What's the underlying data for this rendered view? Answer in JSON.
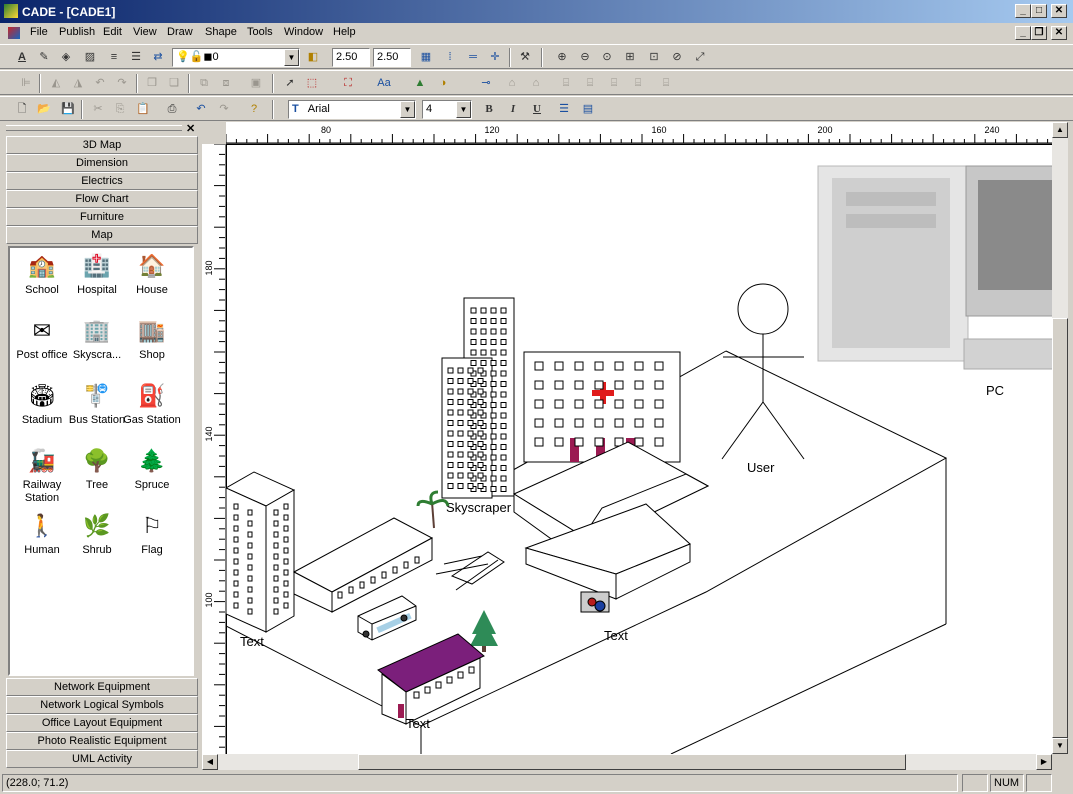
{
  "window": {
    "title": "CADE - [CADE1]"
  },
  "menu": [
    "File",
    "Publish",
    "Edit",
    "View",
    "Draw",
    "Shape",
    "Tools",
    "Window",
    "Help"
  ],
  "toolbar": {
    "layer_value": "0",
    "line_width": "2.50",
    "line_spacing": "2.50",
    "font_name": "Arial",
    "font_size": "4",
    "bold": "B",
    "italic": "I",
    "underline": "U"
  },
  "library": {
    "categories_top": [
      "3D Map",
      "Dimension",
      "Electrics",
      "Flow Chart",
      "Furniture",
      "Map"
    ],
    "categories_bottom": [
      "Network Equipment",
      "Network Logical Symbols",
      "Office Layout Equipment",
      "Photo Realistic Equipment",
      "UML Activity"
    ],
    "shapes": [
      {
        "label": "School",
        "icon": "school-icon"
      },
      {
        "label": "Hospital",
        "icon": "hospital-icon"
      },
      {
        "label": "House",
        "icon": "house-icon"
      },
      {
        "label": "Post office",
        "icon": "post-office-icon"
      },
      {
        "label": "Skyscra...",
        "icon": "skyscraper-icon"
      },
      {
        "label": "Shop",
        "icon": "shop-icon"
      },
      {
        "label": "Stadium",
        "icon": "stadium-icon"
      },
      {
        "label": "Bus Station",
        "icon": "bus-station-icon"
      },
      {
        "label": "Gas Station",
        "icon": "gas-station-icon"
      },
      {
        "label": "Railway Station",
        "icon": "railway-station-icon"
      },
      {
        "label": "Tree",
        "icon": "tree-icon"
      },
      {
        "label": "Spruce",
        "icon": "spruce-icon"
      },
      {
        "label": "Human",
        "icon": "human-icon"
      },
      {
        "label": "Shrub",
        "icon": "shrub-icon"
      },
      {
        "label": "Flag",
        "icon": "flag-icon"
      }
    ]
  },
  "ruler": {
    "top_ticks": [
      "80",
      "120",
      "160",
      "200",
      "240"
    ],
    "left_ticks": [
      "180",
      "140",
      "100"
    ]
  },
  "drawing": {
    "labels": {
      "skyscraper": "Skyscraper",
      "user": "User",
      "pc": "PC",
      "text1": "Text",
      "text2": "Text",
      "text3": "Text"
    }
  },
  "status": {
    "coords": "(228.0; 71.2)",
    "num": "NUM"
  }
}
